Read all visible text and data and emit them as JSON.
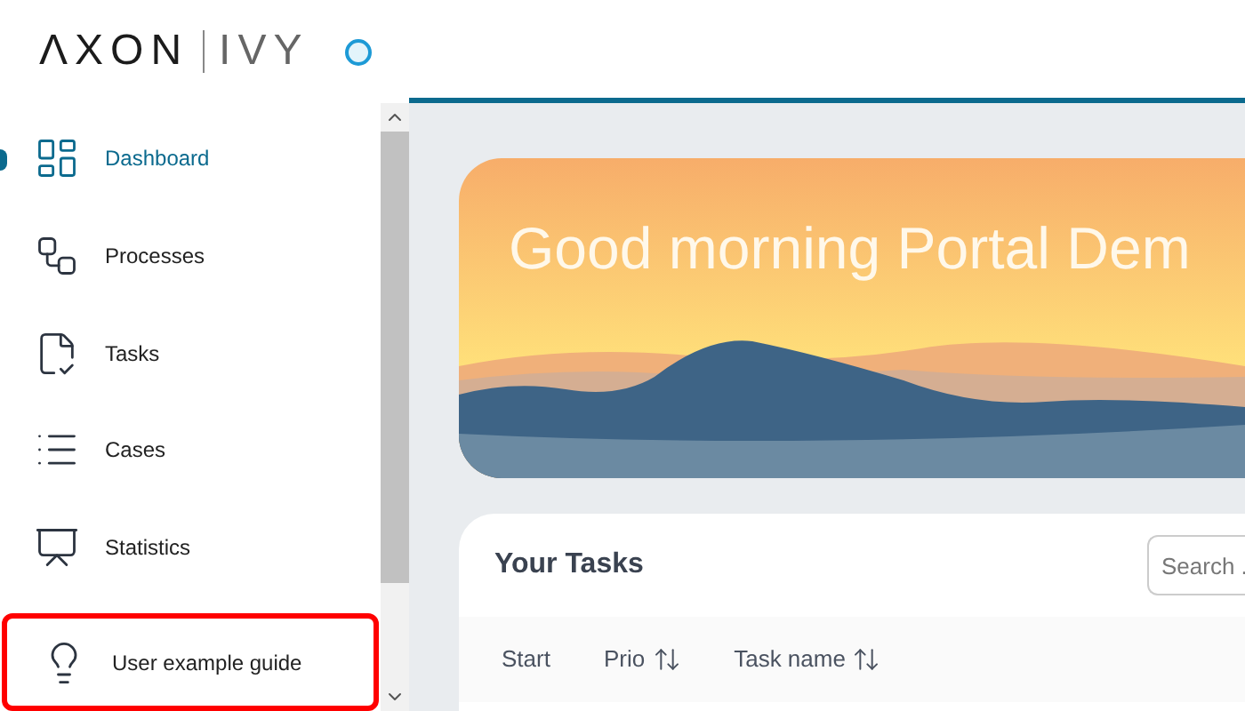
{
  "logo": {
    "main": "ΛXON",
    "light": "IVY"
  },
  "sidebar": {
    "items": [
      {
        "label": "Dashboard",
        "kind": "dashboard",
        "selected": true,
        "highlighted": false
      },
      {
        "label": "Processes",
        "kind": "processes",
        "selected": false,
        "highlighted": false
      },
      {
        "label": "Tasks",
        "kind": "tasks",
        "selected": false,
        "highlighted": false
      },
      {
        "label": "Cases",
        "kind": "cases",
        "selected": false,
        "highlighted": false
      },
      {
        "label": "Statistics",
        "kind": "statistics",
        "selected": false,
        "highlighted": false
      },
      {
        "label": "User example guide",
        "kind": "guide",
        "selected": false,
        "highlighted": true
      }
    ]
  },
  "banner": {
    "greeting": "Good morning Portal Dem"
  },
  "tasks_widget": {
    "title": "Your Tasks",
    "search": {
      "placeholder": "Search ."
    },
    "columns": [
      {
        "label": "Start",
        "sortable": false
      },
      {
        "label": "Prio",
        "sortable": true
      },
      {
        "label": "Task name",
        "sortable": true
      }
    ]
  }
}
